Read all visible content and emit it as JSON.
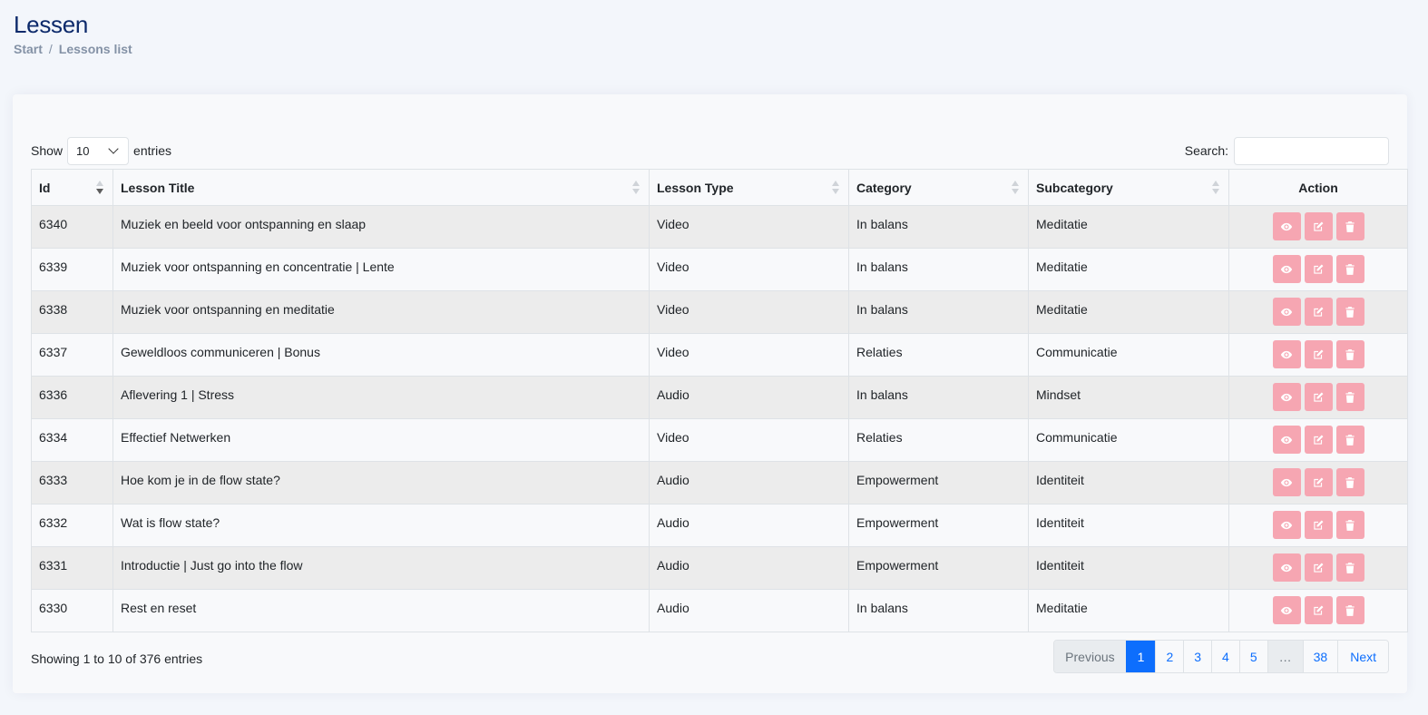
{
  "header": {
    "title": "Lessen",
    "breadcrumb": [
      "Start",
      "Lessons list"
    ],
    "separator": "/"
  },
  "controls": {
    "show_label": "Show",
    "length_value": "10",
    "entries_label": "entries",
    "search_label": "Search:",
    "search_value": ""
  },
  "table": {
    "columns": [
      "Id",
      "Lesson Title",
      "Lesson Type",
      "Category",
      "Subcategory",
      "Action"
    ],
    "rows": [
      [
        "6340",
        "Muziek en beeld voor ontspanning en slaap",
        "Video",
        "In balans",
        "Meditatie"
      ],
      [
        "6339",
        "Muziek voor ontspanning en concentratie | Lente",
        "Video",
        "In balans",
        "Meditatie"
      ],
      [
        "6338",
        "Muziek voor ontspanning en meditatie",
        "Video",
        "In balans",
        "Meditatie"
      ],
      [
        "6337",
        "Geweldloos communiceren | Bonus",
        "Video",
        "Relaties",
        "Communicatie"
      ],
      [
        "6336",
        "Aflevering 1 | Stress",
        "Audio",
        "In balans",
        "Mindset"
      ],
      [
        "6334",
        "Effectief Netwerken",
        "Video",
        "Relaties",
        "Communicatie"
      ],
      [
        "6333",
        "Hoe kom je in de flow state?",
        "Audio",
        "Empowerment",
        "Identiteit"
      ],
      [
        "6332",
        "Wat is flow state?",
        "Audio",
        "Empowerment",
        "Identiteit"
      ],
      [
        "6331",
        "Introductie | Just go into the flow",
        "Audio",
        "Empowerment",
        "Identiteit"
      ],
      [
        "6330",
        "Rest en reset",
        "Audio",
        "In balans",
        "Meditatie"
      ]
    ],
    "row_action_icons": [
      "eye-icon",
      "edit-icon",
      "trash-icon"
    ]
  },
  "footer": {
    "info": "Showing 1 to 10 of 376 entries",
    "pagination": [
      "Previous",
      "1",
      "2",
      "3",
      "4",
      "5",
      "…",
      "38",
      "Next"
    ],
    "active_page": "1"
  },
  "colors": {
    "title": "#0d2a6b",
    "accent": "#0d6efd",
    "action_button": "#f6a6b2",
    "striped_row": "#ececec"
  }
}
